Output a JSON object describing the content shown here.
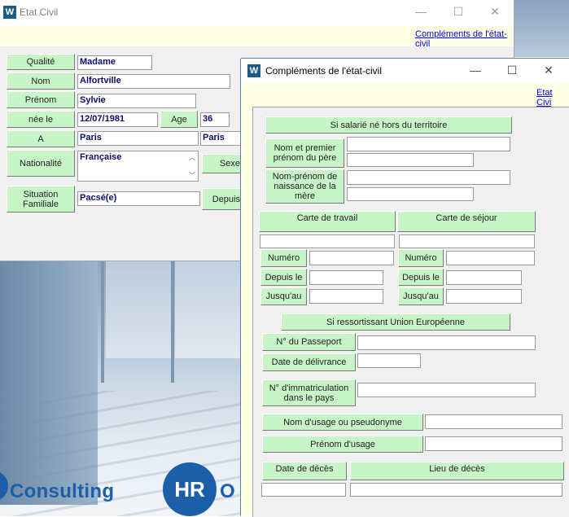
{
  "window1": {
    "title": "Etat Civil",
    "link": "Compléments de l'état-civil",
    "controls": {
      "minimize": "—",
      "maximize": "☐",
      "close": "✕"
    },
    "fields": {
      "qualite": {
        "label": "Qualité",
        "value": "Madame"
      },
      "nom": {
        "label": "Nom",
        "value": "Alfortville"
      },
      "prenom": {
        "label": "Prénom",
        "value": "Sylvie"
      },
      "nee_le": {
        "label": "née le",
        "value": "12/07/1981"
      },
      "age": {
        "label": "Age",
        "value": "36"
      },
      "a": {
        "label": "A",
        "value": "Paris",
        "value2": "Paris"
      },
      "nationalite": {
        "label": "Nationalité",
        "value": "Française"
      },
      "sexe": {
        "label": "Sexe"
      },
      "situation": {
        "label": "Situation Familiale",
        "value": "Pacsé(e)"
      },
      "depuis": {
        "label": "Depuis"
      }
    }
  },
  "window2": {
    "title": "Compléments de l'état-civil",
    "link": "Etat Civi",
    "controls": {
      "minimize": "—",
      "maximize": "☐",
      "close": "✕"
    },
    "section_salarie": "Si salarié né hors du territoire",
    "nom_pere": "Nom et premier prénom du père",
    "nom_mere": "Nom-prénom de naissance de la mère",
    "carte_travail": "Carte de travail",
    "carte_sejour": "Carte de séjour",
    "numero": "Numéro",
    "depuis_le": "Depuis le",
    "jusquau": "Jusqu'au",
    "section_ue": "Si ressortissant Union Européenne",
    "passeport": "N° du Passeport",
    "date_delivrance": "Date de délivrance",
    "immatriculation": "N° d'immatriculation dans le pays",
    "nom_usage": "Nom d'usage ou pseudonyme",
    "prenom_usage": "Prénom d'usage",
    "date_deces": "Date de décès",
    "lieu_deces": "Lieu de décès"
  },
  "branding": {
    "consulting": "Consulting",
    "hr": "HR",
    "o": "O"
  }
}
